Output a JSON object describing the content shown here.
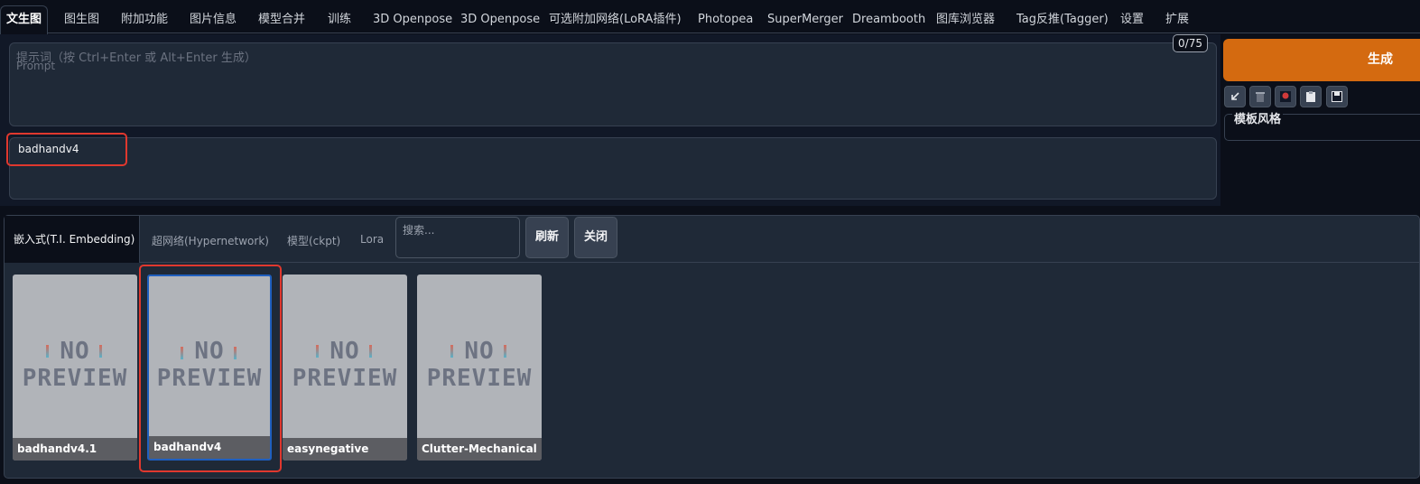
{
  "tabs": [
    "文生图",
    "图生图",
    "附加功能",
    "图片信息",
    "模型合并",
    "训练",
    "3D Openpose",
    "3D Openpose",
    "可选附加网络(LoRA插件)",
    "Photopea",
    "SuperMerger",
    "Dreambooth",
    "图库浏览器",
    "Tag反推(Tagger)",
    "设置",
    "扩展"
  ],
  "prompt": {
    "placeholder_line1": "提示词（按 Ctrl+Enter 或 Alt+Enter 生成）",
    "placeholder_line2": "Prompt",
    "token_count": "0/75",
    "negative_value": "badhandv4"
  },
  "generate_label": "生成",
  "tool_icons": [
    "arrow-in-icon",
    "trash-icon",
    "record-icon",
    "clipboard-icon",
    "save-icon"
  ],
  "styles_label": "模板风格",
  "networks": {
    "tabs": [
      "嵌入式(T.I. Embedding)",
      "超网络(Hypernetwork)",
      "模型(ckpt)",
      "Lora"
    ],
    "search_placeholder": "搜索...",
    "refresh_label": "刷新",
    "close_label": "关闭",
    "no_preview_line1": "NO",
    "no_preview_line2": "PREVIEW",
    "cards": [
      "badhandv4.1",
      "badhandv4",
      "easynegative",
      "Clutter-Mechanical"
    ],
    "selected_card": 1
  },
  "colors": {
    "accent": "#d46a10",
    "highlight": "#e0382e",
    "selected_border": "#1f5fbf",
    "background": "#0b0f19"
  }
}
